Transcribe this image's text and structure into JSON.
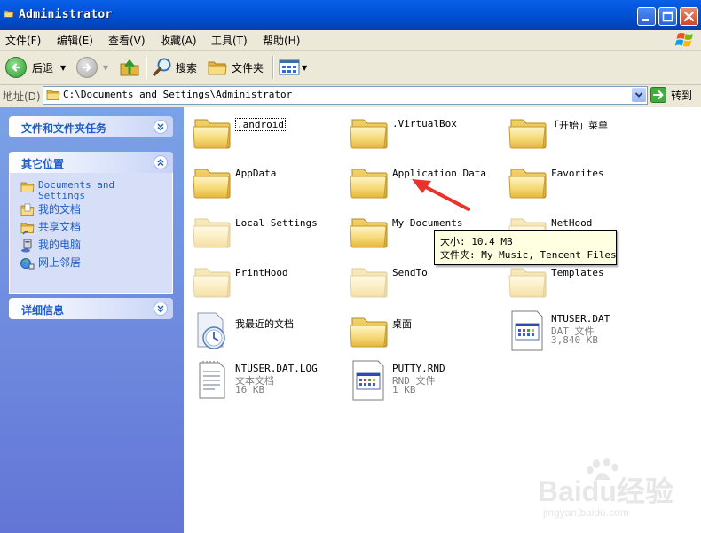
{
  "window": {
    "title": "Administrator"
  },
  "menu": [
    "文件(F)",
    "编辑(E)",
    "查看(V)",
    "收藏(A)",
    "工具(T)",
    "帮助(H)"
  ],
  "toolbar": {
    "back": "后退",
    "search": "搜索",
    "folders": "文件夹"
  },
  "address": {
    "label": "地址(D)",
    "path": "C:\\Documents and Settings\\Administrator",
    "go": "转到"
  },
  "sidebar": {
    "tasks_title": "文件和文件夹任务",
    "places_title": "其它位置",
    "places": [
      "Documents and Settings",
      "我的文档",
      "共享文档",
      "我的电脑",
      "网上邻居"
    ],
    "details_title": "详细信息"
  },
  "items": [
    {
      "name": ".android",
      "type": "folder"
    },
    {
      "name": ".VirtualBox",
      "type": "folder"
    },
    {
      "name": "「开始」菜单",
      "type": "folder"
    },
    {
      "name": "AppData",
      "type": "folder"
    },
    {
      "name": "Application Data",
      "type": "folder"
    },
    {
      "name": "Favorites",
      "type": "folder"
    },
    {
      "name": "Local Settings",
      "type": "folder-hidden"
    },
    {
      "name": "My Documents",
      "type": "folder"
    },
    {
      "name": "NetHood",
      "type": "folder-hidden"
    },
    {
      "name": "PrintHood",
      "type": "folder-hidden"
    },
    {
      "name": "SendTo",
      "type": "folder-hidden"
    },
    {
      "name": "Templates",
      "type": "folder-hidden"
    },
    {
      "name": "我最近的文档",
      "type": "recent"
    },
    {
      "name": "桌面",
      "type": "folder"
    },
    {
      "name": "NTUSER.DAT",
      "type": "file-dat",
      "sub1": "DAT 文件",
      "sub2": "3,840 KB"
    },
    {
      "name": "NTUSER.DAT.LOG",
      "type": "file-txt",
      "sub1": "文本文档",
      "sub2": "16 KB"
    },
    {
      "name": "PUTTY.RND",
      "type": "file-dat",
      "sub1": "RND 文件",
      "sub2": "1 KB"
    }
  ],
  "tooltip": {
    "line1": "大小: 10.4 MB",
    "line2": "文件夹: My Music, Tencent Files"
  },
  "watermark": {
    "line1": "Baidu经验",
    "line2": "jingyan.baidu.com"
  },
  "colors": {
    "titlebar": "#0052d6",
    "sidebar": "#6f8fe0",
    "link": "#215dc6",
    "tooltip": "#ffffe1",
    "arrow": "#e8322a"
  }
}
